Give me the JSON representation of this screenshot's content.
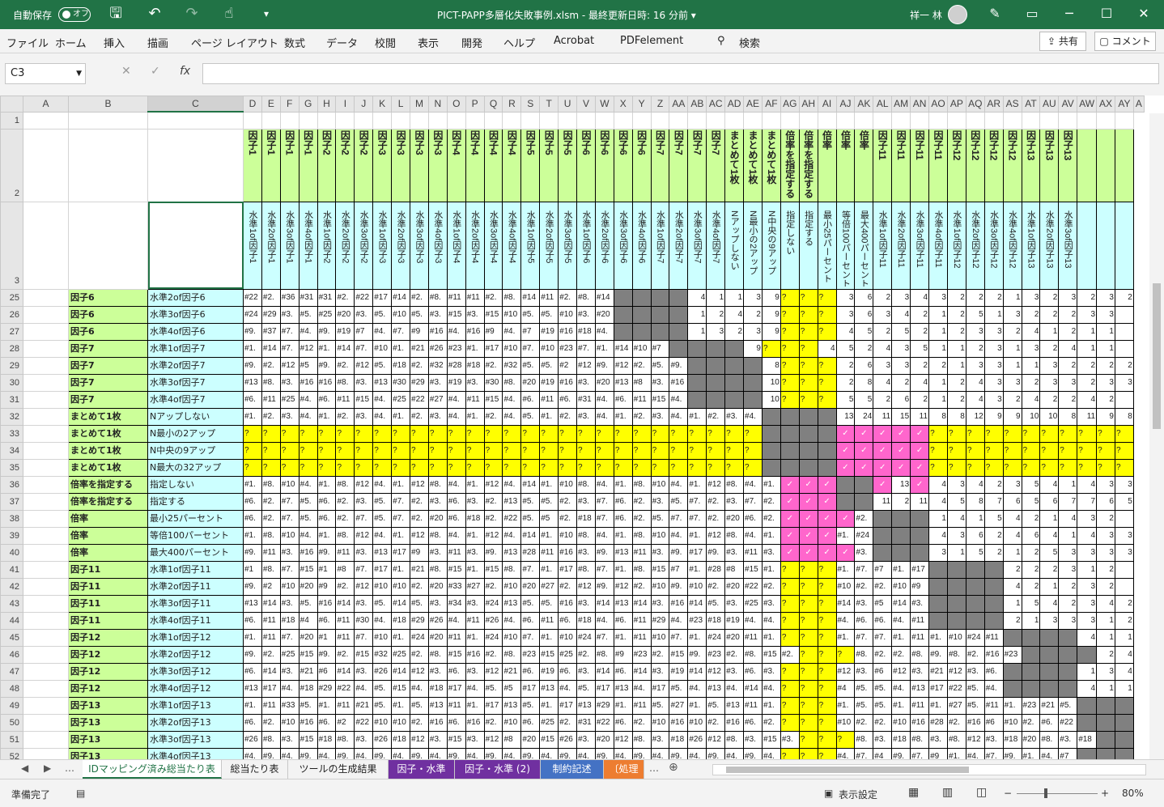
{
  "titlebar": {
    "autosave_label": "自動保存",
    "autosave_state": "オフ",
    "doc_title": "PICT-PAPP多層化失敗事例.xlsm  -  最終更新日時: 16 分前  ▾",
    "user_name": "祥一 林"
  },
  "ribbon": {
    "tabs": [
      "ファイル",
      "ホーム",
      "挿入",
      "描画",
      "ページ レイアウト",
      "数式",
      "データ",
      "校閲",
      "表示",
      "開発",
      "ヘルプ",
      "Acrobat",
      "PDFelement",
      "検索"
    ],
    "share": "共有",
    "comment": "コメント"
  },
  "formula": {
    "name_box": "C3",
    "fx": "fx",
    "cancel": "✕",
    "enter": "✓",
    "value": ""
  },
  "columns": [
    "A",
    "B",
    "C",
    "D",
    "E",
    "F",
    "G",
    "H",
    "I",
    "J",
    "K",
    "L",
    "M",
    "N",
    "O",
    "P",
    "Q",
    "R",
    "S",
    "T",
    "U",
    "V",
    "W",
    "X",
    "Y",
    "Z",
    "AA",
    "AB",
    "AC",
    "AD",
    "AE",
    "AF",
    "AG",
    "AH",
    "AI",
    "AJ",
    "AK",
    "AL",
    "AM",
    "AN",
    "AO",
    "AP",
    "AQ",
    "AR",
    "AS",
    "AT",
    "AU",
    "AV",
    "AW",
    "AX",
    "AY",
    "A"
  ],
  "header_row2": [
    "因子1",
    "因子1",
    "因子1",
    "因子1",
    "因子2",
    "因子2",
    "因子2",
    "因子3",
    "因子3",
    "因子3",
    "因子3",
    "因子4",
    "因子4",
    "因子4",
    "因子4",
    "因子5",
    "因子5",
    "因子5",
    "因子6",
    "因子6",
    "因子6",
    "因子6",
    "因子7",
    "因子7",
    "因子7",
    "因子7",
    "まとめて1枚",
    "まとめて1枚",
    "まとめて1枚",
    "倍率を指定する",
    "倍率を指定する",
    "倍率",
    "倍率",
    "倍率",
    "因子11",
    "因子11",
    "因子11",
    "因子11",
    "因子12",
    "因子12",
    "因子12",
    "因子12",
    "因子13",
    "因子13",
    "因子13"
  ],
  "header_row3": [
    "水準1of因子1",
    "水準2of因子1",
    "水準3of因子1",
    "水準4of因子1",
    "水準1of因子2",
    "水準2of因子2",
    "水準3of因子2",
    "水準1of因子3",
    "水準2of因子3",
    "水準3of因子3",
    "水準4of因子3",
    "水準1of因子4",
    "水準2of因子4",
    "水準3of因子4",
    "水準4of因子4",
    "水準1of因子5",
    "水準2of因子5",
    "水準3of因子5",
    "水準1of因子6",
    "水準2of因子6",
    "水準3of因子6",
    "水準4of因子6",
    "水準1of因子7",
    "水準2of因子7",
    "水準3of因子7",
    "水準4of因子7",
    "Nアップしない",
    "N最小の2アップ",
    "N中央の9アップ",
    "指定しない",
    "指定する",
    "最小25パーセント",
    "等倍100パーセント",
    "最大400パーセント",
    "水準1of因子11",
    "水準2of因子11",
    "水準3of因子11",
    "水準4of因子11",
    "水準1of因子12",
    "水準2of因子12",
    "水準3of因子12",
    "水準4of因子12",
    "水準1of因子13",
    "水準2of因子13",
    "水準3of因子13"
  ],
  "rows": [
    {
      "n": "25",
      "f": "因子6",
      "l": "水準2of因子6",
      "c": "#22|#2.|#36|#31|#31|#2.|#22|#17|#14|#2.|#8.|#11|#11|#2.|#8.|#14|#11|#2.|#8.|#14|—|—|—|—|4|1|1|3|9|?|?|?|3|6|2|3|4|3|2|2|2|1|3|2|3|2|3|2"
    },
    {
      "n": "26",
      "f": "因子6",
      "l": "水準3of因子6",
      "c": "#24|#29|#3.|#5.|#25|#20|#3.|#5.|#10|#5.|#3.|#15|#3.|#15|#10|#5.|#5.|#10|#3.|#20|—|—|—|—|1|2|4|2|9|?|?|?|3|6|3|4|2|1|2|5|1|3|2|2|2|3|3"
    },
    {
      "n": "27",
      "f": "因子6",
      "l": "水準4of因子6",
      "c": "#9.|#37|#7.|#4.|#9.|#19|#7|#4.|#7.|#9|#16|#4.|#16|#9|#4.|#7|#19|#16|#18|#4.|—|—|—|—|1|3|2|3|9|?|?|?|4|5|2|5|2|1|2|3|3|2|4|1|2|1|1"
    },
    {
      "n": "28",
      "f": "因子7",
      "l": "水準1of因子7",
      "c": "#1.|#14|#7.|#12|#1.|#14|#7.|#10|#1.|#21|#26|#23|#1.|#17|#10|#7.|#10|#23|#7.|#1.|#14|#10|#7|—|—|—|—|9|?|?|?|4|5|2|4|3|5|1|1|2|3|1|3|2|4|1|1"
    },
    {
      "n": "29",
      "f": "因子7",
      "l": "水準2of因子7",
      "c": "#9.|#2.|#12|#5|#9.|#2.|#12|#5.|#18|#2.|#32|#28|#18|#2.|#32|#5.|#5.|#2|#12|#9.|#12|#2.|#5.|#9.|—|—|—|—|8|?|?|?|2|6|3|3|2|2|1|3|3|1|1|3|2|2|2|2"
    },
    {
      "n": "30",
      "f": "因子7",
      "l": "水準3of因子7",
      "c": "#13|#8.|#3.|#16|#16|#8.|#3.|#13|#30|#29|#3.|#19|#3.|#30|#8.|#20|#19|#16|#3.|#20|#13|#8|#3.|#16|—|—|—|—|10|?|?|?|2|8|4|2|4|1|2|4|3|3|2|3|3|2|3|3"
    },
    {
      "n": "31",
      "f": "因子7",
      "l": "水準4of因子7",
      "c": "#6.|#11|#25|#4.|#6.|#11|#15|#4.|#25|#22|#27|#4.|#11|#15|#4.|#6.|#11|#6.|#31|#4.|#6.|#11|#15|#4.|—|—|—|—|10|?|?|?|5|5|2|6|2|1|2|4|3|2|4|2|2|4|2"
    },
    {
      "n": "32",
      "f": "まとめて1枚",
      "l": "Nアップしない",
      "c": "#1.|#2.|#3.|#4.|#1.|#2.|#3.|#4.|#1.|#2.|#3.|#4.|#1.|#2.|#4.|#5.|#1.|#2.|#3.|#4.|#1.|#2.|#3.|#4.|#1.|#2.|#3.|#4.|—|—|—|—|13|24|11|15|11|8|8|12|9|9|10|10|8|11|9|8"
    },
    {
      "n": "33",
      "f": "まとめて1枚",
      "l": "N最小の2アップ",
      "c": "?|?|?|?|?|?|?|?|?|?|?|?|?|?|?|?|?|?|?|?|?|?|?|?|?|?|?|?|—|—|—|—|✓|✓|✓|✓|✓|?|?|?|?|?|?|?|?|?|?|?"
    },
    {
      "n": "34",
      "f": "まとめて1枚",
      "l": "N中央の9アップ",
      "c": "?|?|?|?|?|?|?|?|?|?|?|?|?|?|?|?|?|?|?|?|?|?|?|?|?|?|?|?|—|—|—|—|✓|✓|✓|✓|✓|?|?|?|?|?|?|?|?|?|?|?"
    },
    {
      "n": "35",
      "f": "まとめて1枚",
      "l": "N最大の32アップ",
      "c": "?|?|?|?|?|?|?|?|?|?|?|?|?|?|?|?|?|?|?|?|?|?|?|?|?|?|?|?|—|—|—|—|✓|✓|✓|✓|✓|?|?|?|?|?|?|?|?|?|?|?"
    },
    {
      "n": "36",
      "f": "倍率を指定する",
      "l": "指定しない",
      "c": "#1.|#8.|#10|#4.|#1.|#8.|#12|#4.|#1.|#12|#8.|#4.|#1.|#12|#4.|#14|#1.|#10|#8.|#4.|#1.|#8.|#10|#4.|#1.|#12|#8.|#4.|#1.|✓|✓|✓|—|—|✓|13|✓|4|3|4|2|3|5|4|1|4|3|3"
    },
    {
      "n": "37",
      "f": "倍率を指定する",
      "l": "指定する",
      "c": "#6.|#2.|#7.|#5.|#6.|#2.|#3.|#5.|#7.|#2.|#3.|#6.|#3.|#2.|#13|#5.|#5.|#2.|#3.|#7.|#6.|#2.|#3.|#5.|#7.|#2.|#3.|#7.|#2.|✓|✓|✓|—|—|11|2|11|4|5|8|7|6|5|6|7|7|6|5"
    },
    {
      "n": "38",
      "f": "倍率",
      "l": "最小25パーセント",
      "c": "#6.|#2.|#7.|#5.|#6.|#2.|#7.|#5.|#7.|#2.|#20|#6.|#18|#2.|#22|#5.|#5|#2.|#18|#7.|#6.|#2.|#5.|#7.|#7.|#2.|#20|#6.|#2.|✓|✓|✓|✓|#2.|—|—|—|1|4|1|5|4|2|1|4|3|2"
    },
    {
      "n": "39",
      "f": "倍率",
      "l": "等倍100パーセント",
      "c": "#1.|#8.|#10|#4.|#1.|#8.|#12|#4.|#1.|#12|#8.|#4.|#1.|#12|#4.|#14|#1.|#10|#8.|#4.|#1.|#8.|#10|#4.|#1.|#12|#8.|#4.|#1.|✓|✓|✓|#1.|#24|—|—|—|4|3|6|2|4|6|4|1|4|3|3"
    },
    {
      "n": "40",
      "f": "倍率",
      "l": "最大400パーセント",
      "c": "#9.|#11|#3.|#16|#9.|#11|#3.|#13|#17|#9|#3.|#11|#3.|#9.|#13|#28|#11|#16|#3.|#9.|#13|#11|#3.|#9.|#17|#9.|#3.|#11|#3.|✓|✓|✓|✓|#3.|—|—|—|3|1|5|2|1|2|5|3|3|3|3"
    },
    {
      "n": "41",
      "f": "因子11",
      "l": "水準1of因子11",
      "c": "#1|#8.|#7.|#15|#1|#8|#7.|#17|#1.|#21|#8.|#15|#1.|#15|#8.|#7.|#1.|#17|#8.|#7.|#1.|#8.|#15|#7|#1.|#28|#8|#15|#1.|?|?|?|#1.|#7.|#7|#1.|#17|—|—|—|—|2|2|2|3|1|2"
    },
    {
      "n": "42",
      "f": "因子11",
      "l": "水準2of因子11",
      "c": "#9.|#2|#10|#20|#9|#2.|#12|#10|#10|#2.|#20|#33|#27|#2.|#10|#20|#27|#2.|#12|#9.|#12|#2.|#10|#9.|#10|#2.|#20|#22|#2.|?|?|?|#10|#2.|#2.|#10|#9|—|—|—|—|4|2|1|2|3|2"
    },
    {
      "n": "43",
      "f": "因子11",
      "l": "水準3of因子11",
      "c": "#13|#14|#3.|#5.|#16|#14|#3.|#5.|#14|#5.|#3.|#34|#3.|#24|#13|#5.|#5.|#16|#3.|#14|#13|#14|#3.|#16|#14|#5.|#3.|#25|#3.|?|?|?|#14|#3.|#5|#14|#3.|—|—|—|—|1|5|4|2|3|4|2"
    },
    {
      "n": "44",
      "f": "因子11",
      "l": "水準4of因子11",
      "c": "#6.|#11|#18|#4|#6.|#11|#30|#4.|#18|#29|#26|#4.|#11|#26|#4.|#6.|#11|#6.|#18|#4.|#6.|#11|#29|#4.|#23|#18|#19|#4.|#4.|?|?|?|#4.|#6.|#6.|#4.|#11|—|—|—|—|2|1|3|3|3|1|2"
    },
    {
      "n": "45",
      "f": "因子12",
      "l": "水準1of因子12",
      "c": "#1.|#11|#7.|#20|#1|#11|#7.|#10|#1.|#24|#20|#11|#1.|#24|#10|#7.|#1.|#10|#24|#7.|#1.|#11|#10|#7.|#1.|#24|#20|#11|#1.|?|?|?|#1.|#7.|#7.|#1.|#11|#1.|#10|#24|#11|—|—|—|—|4|1|1"
    },
    {
      "n": "46",
      "f": "因子12",
      "l": "水準2of因子12",
      "c": "#9.|#2.|#25|#15|#9.|#2.|#15|#32|#25|#2.|#8.|#15|#16|#2.|#8.|#23|#15|#25|#2.|#8.|#9|#23|#2.|#15|#9.|#23|#2.|#8.|#15|#2.|?|?|?|#8.|#2.|#2.|#8.|#9.|#8.|#2.|#16|#23|—|—|—|—|2|4|2"
    },
    {
      "n": "47",
      "f": "因子12",
      "l": "水準3of因子12",
      "c": "#6.|#14|#3.|#21|#6|#14|#3.|#26|#14|#12|#3.|#6.|#3.|#12|#21|#6.|#19|#6.|#3.|#14|#6.|#14|#3.|#19|#14|#12|#3.|#6.|#3.|?|?|?|#12|#3.|#6|#12|#3.|#21|#12|#3.|#6.|—|—|—|—|1|3|4"
    },
    {
      "n": "48",
      "f": "因子12",
      "l": "水準4of因子12",
      "c": "#13|#17|#4.|#18|#29|#22|#4.|#5.|#15|#4.|#18|#17|#4.|#5.|#5|#17|#13|#4.|#5.|#17|#13|#4.|#17|#5.|#4.|#13|#4.|#14|#4.|?|?|?|#4|#5.|#5.|#4.|#13|#17|#22|#5.|#4.|—|—|—|—|4|1|1"
    },
    {
      "n": "49",
      "f": "因子13",
      "l": "水準1of因子13",
      "c": "#1.|#11|#33|#5.|#1.|#11|#21|#5.|#1.|#5.|#13|#11|#1.|#17|#13|#5.|#1.|#17|#13|#29|#1.|#11|#5.|#27|#1.|#5.|#13|#11|#1.|?|?|?|#1.|#5.|#5.|#1.|#11|#1.|#27|#5.|#11|#1.|#23|#21|#5.|—|—|—|—"
    },
    {
      "n": "50",
      "f": "因子13",
      "l": "水準2of因子13",
      "c": "#6.|#2.|#10|#16|#6.|#2|#22|#10|#10|#2.|#16|#6.|#16|#2.|#10|#6.|#25|#2.|#31|#22|#6.|#2.|#10|#16|#10|#2.|#16|#6.|#2.|?|?|?|#10|#2.|#2.|#10|#16|#28|#2.|#16|#6|#10|#2.|#6.|#22|—|—|—|—"
    },
    {
      "n": "51",
      "f": "因子13",
      "l": "水準3of因子13",
      "c": "#26|#8.|#3.|#15|#18|#8.|#3.|#26|#18|#12|#3.|#15|#3.|#12|#8|#20|#15|#26|#3.|#20|#12|#8.|#3.|#18|#26|#12|#8.|#3.|#15|#3.|?|?|?|#8.|#3.|#18|#8.|#3.|#8.|#12|#3.|#18|#20|#8.|#3.|#18|—|—|—|—"
    },
    {
      "n": "52",
      "f": "因子13",
      "l": "水準4of因子13",
      "c": "#4.|#9.|#4.|#9.|#4.|#9.|#4.|#9.|#4.|#9.|#4.|#9.|#4.|#9.|#4.|#9.|#4.|#9.|#4.|#9.|#4.|#9.|#4.|#9.|#4.|#9.|#4.|#9.|#4.|?|?|?|#4.|#7.|#4|#9.|#7.|#9|#1.|#4.|#7.|#9.|#1.|#4.|#7|—|—|—|—"
    }
  ],
  "sheet_tabs": [
    "IDマッピング済み総当たり表",
    "総当たり表",
    "ツールの生成結果",
    "因子・水準",
    "因子・水準 (2)",
    "制約記述",
    "〔処理"
  ],
  "status": {
    "ready": "準備完了",
    "display_settings": "表示設定",
    "zoom": "80%"
  },
  "colors": {
    "excel_green": "#217346",
    "header_green": "#ccff99",
    "level_cyan": "#ccffff",
    "unknown_yellow": "#ffff00",
    "pair_pink": "#ff66cc",
    "blocked_gray": "#808080"
  }
}
